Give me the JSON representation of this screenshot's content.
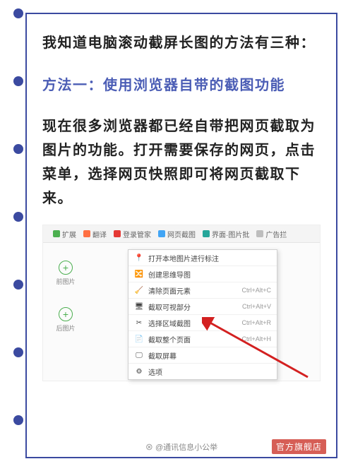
{
  "article": {
    "intro": "我知道电脑滚动截屏长图的方法有三种：",
    "method_title": "方法一：使用浏览器自带的截图功能",
    "body": "现在很多浏览器都已经自带把网页截取为图片的功能。打开需要保存的网页，点击菜单，选择网页快照即可将网页截取下来。"
  },
  "toolbar": {
    "items": [
      "扩展",
      "翻译",
      "登录管家",
      "网页截图",
      "界面·图片批",
      "广告拦"
    ]
  },
  "left_tabs": {
    "before": "前图片",
    "after": "后图片"
  },
  "menu": {
    "rows": [
      {
        "icon": "📍",
        "label": "打开本地图片进行标注",
        "shortcut": ""
      },
      {
        "icon": "🔀",
        "label": "创建思维导图",
        "shortcut": ""
      },
      {
        "icon": "🧹",
        "label": "清除页面元素",
        "shortcut": "Ctrl+Alt+C"
      },
      {
        "icon": "🖥",
        "label": "截取可视部分",
        "shortcut": "Ctrl+Alt+V"
      },
      {
        "icon": "✂",
        "label": "选择区域截图",
        "shortcut": "Ctrl+Alt+R"
      },
      {
        "icon": "📄",
        "label": "截取整个页面",
        "shortcut": "Ctrl+Alt+H"
      },
      {
        "icon": "🖵",
        "label": "截取屏幕",
        "shortcut": ""
      },
      {
        "icon": "⚙",
        "label": "选项",
        "shortcut": ""
      }
    ]
  },
  "footer": {
    "source": "⊗ @通讯信息小公举",
    "watermark": "官方旗舰店"
  }
}
